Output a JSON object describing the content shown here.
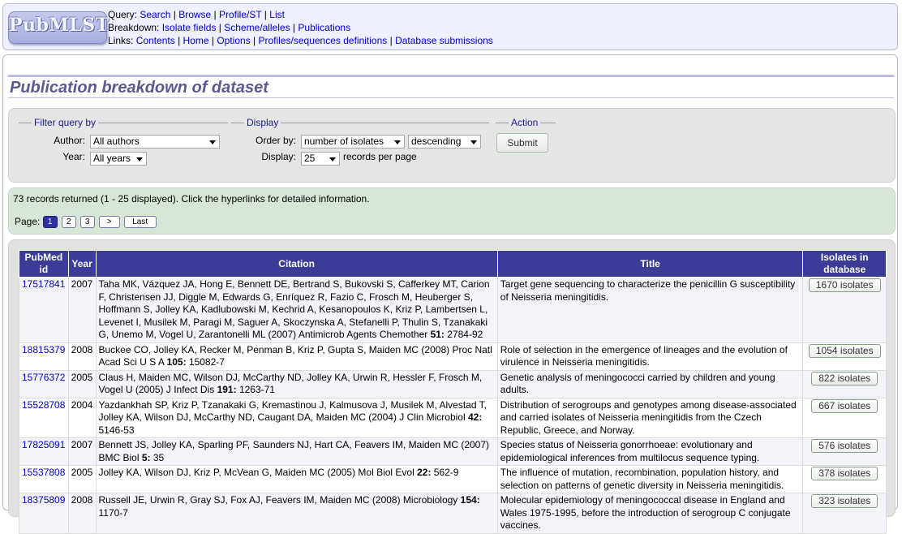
{
  "header": {
    "logo_text": "PubMLST",
    "query_label": "Query:",
    "query_links": [
      "Search",
      "Browse",
      "Profile/ST",
      "List"
    ],
    "breakdown_label": "Breakdown:",
    "breakdown_links": [
      "Isolate fields",
      "Scheme/alleles",
      "Publications"
    ],
    "links_label": "Links:",
    "links_links": [
      "Contents",
      "Home",
      "Options",
      "Profiles/sequences definitions",
      "Database submissions"
    ]
  },
  "page_title": "Publication breakdown of dataset",
  "filter": {
    "legend": "Filter query by",
    "author_label": "Author:",
    "author_value": "All authors",
    "year_label": "Year:",
    "year_value": "All years"
  },
  "display": {
    "legend": "Display",
    "order_label": "Order by:",
    "order_value": "number of isolates",
    "direction_value": "descending",
    "display_label": "Display:",
    "display_value": "25",
    "records_per_page": "records per page"
  },
  "action": {
    "legend": "Action",
    "submit_label": "Submit"
  },
  "info": {
    "records_text": "73 records returned (1 - 25 displayed). Click the hyperlinks for detailed information.",
    "page_label": "Page:",
    "pages": [
      "1",
      "2",
      "3",
      ">",
      "Last"
    ],
    "current_page": "1"
  },
  "table": {
    "headers": [
      "PubMed id",
      "Year",
      "Citation",
      "Title",
      "Isolates in database"
    ],
    "rows": [
      {
        "pubmed": "17517841",
        "year": "2007",
        "citation_pre": "Taha MK, Vázquez JA, Hong E, Bennett DE, Bertrand S, Bukovski S, Cafferkey MT, Carion F, Christensen JJ, Diggle M, Edwards G, Enríquez R, Fazio C, Frosch M, Heuberger S, Hoffmann S, Jolley KA, Kadlubowski M, Kechrid A, Kesanopoulos K, Kriz P, Lambertsen L, Levenet I, Musilek M, Paragi M, Saguer A, Skoczynska A, Stefanelli P, Thulin S, Tzanakaki G, Unemo M, Vogel U, Zarantonelli ML (2007) Antimicrob Agents Chemother ",
        "volume": "51:",
        "pages": " 2784-92",
        "title": "Target gene sequencing to characterize the penicillin G susceptibility of Neisseria meningitidis.",
        "isolates": "1670 isolates"
      },
      {
        "pubmed": "18815379",
        "year": "2008",
        "citation_pre": "Buckee CO, Jolley KA, Recker M, Penman B, Kriz P, Gupta S, Maiden MC (2008) Proc Natl Acad Sci U S A ",
        "volume": "105:",
        "pages": " 15082-7",
        "title": "Role of selection in the emergence of lineages and the evolution of virulence in Neisseria meningitidis.",
        "isolates": "1054 isolates"
      },
      {
        "pubmed": "15776372",
        "year": "2005",
        "citation_pre": "Claus H, Maiden MC, Wilson DJ, McCarthy ND, Jolley KA, Urwin R, Hessler F, Frosch M, Vogel U (2005) J Infect Dis ",
        "volume": "191:",
        "pages": " 1263-71",
        "title": "Genetic analysis of meningococci carried by children and young adults.",
        "isolates": "822 isolates"
      },
      {
        "pubmed": "15528708",
        "year": "2004",
        "citation_pre": "Yazdankhah SP, Kriz P, Tzanakaki G, Kremastinou J, Kalmusova J, Musilek M, Alvestad T, Jolley KA, Wilson DJ, McCarthy ND, Caugant DA, Maiden MC (2004) J Clin Microbiol ",
        "volume": "42:",
        "pages": " 5146-53",
        "title": "Distribution of serogroups and genotypes among disease-associated and carried isolates of Neisseria meningitidis from the Czech Republic, Greece, and Norway.",
        "isolates": "667 isolates"
      },
      {
        "pubmed": "17825091",
        "year": "2007",
        "citation_pre": "Bennett JS, Jolley KA, Sparling PF, Saunders NJ, Hart CA, Feavers IM, Maiden MC (2007) BMC Biol ",
        "volume": "5:",
        "pages": " 35",
        "title": "Species status of Neisseria gonorrhoeae: evolutionary and epidemiological inferences from multilocus sequence typing.",
        "isolates": "576 isolates"
      },
      {
        "pubmed": "15537808",
        "year": "2005",
        "citation_pre": "Jolley KA, Wilson DJ, Kriz P, McVean G, Maiden MC (2005) Mol Biol Evol ",
        "volume": "22:",
        "pages": " 562-9",
        "title": "The influence of mutation, recombination, population history, and selection on patterns of genetic diversity in Neisseria meningitidis.",
        "isolates": "378 isolates"
      },
      {
        "pubmed": "18375809",
        "year": "2008",
        "citation_pre": "Russell JE, Urwin R, Gray SJ, Fox AJ, Feavers IM, Maiden MC (2008) Microbiology ",
        "volume": "154:",
        "pages": " 1170-7",
        "title": "Molecular epidemiology of meningococcal disease in England and Wales 1975-1995, before the introduction of serogroup C conjugate vaccines.",
        "isolates": "323 isolates"
      }
    ]
  }
}
